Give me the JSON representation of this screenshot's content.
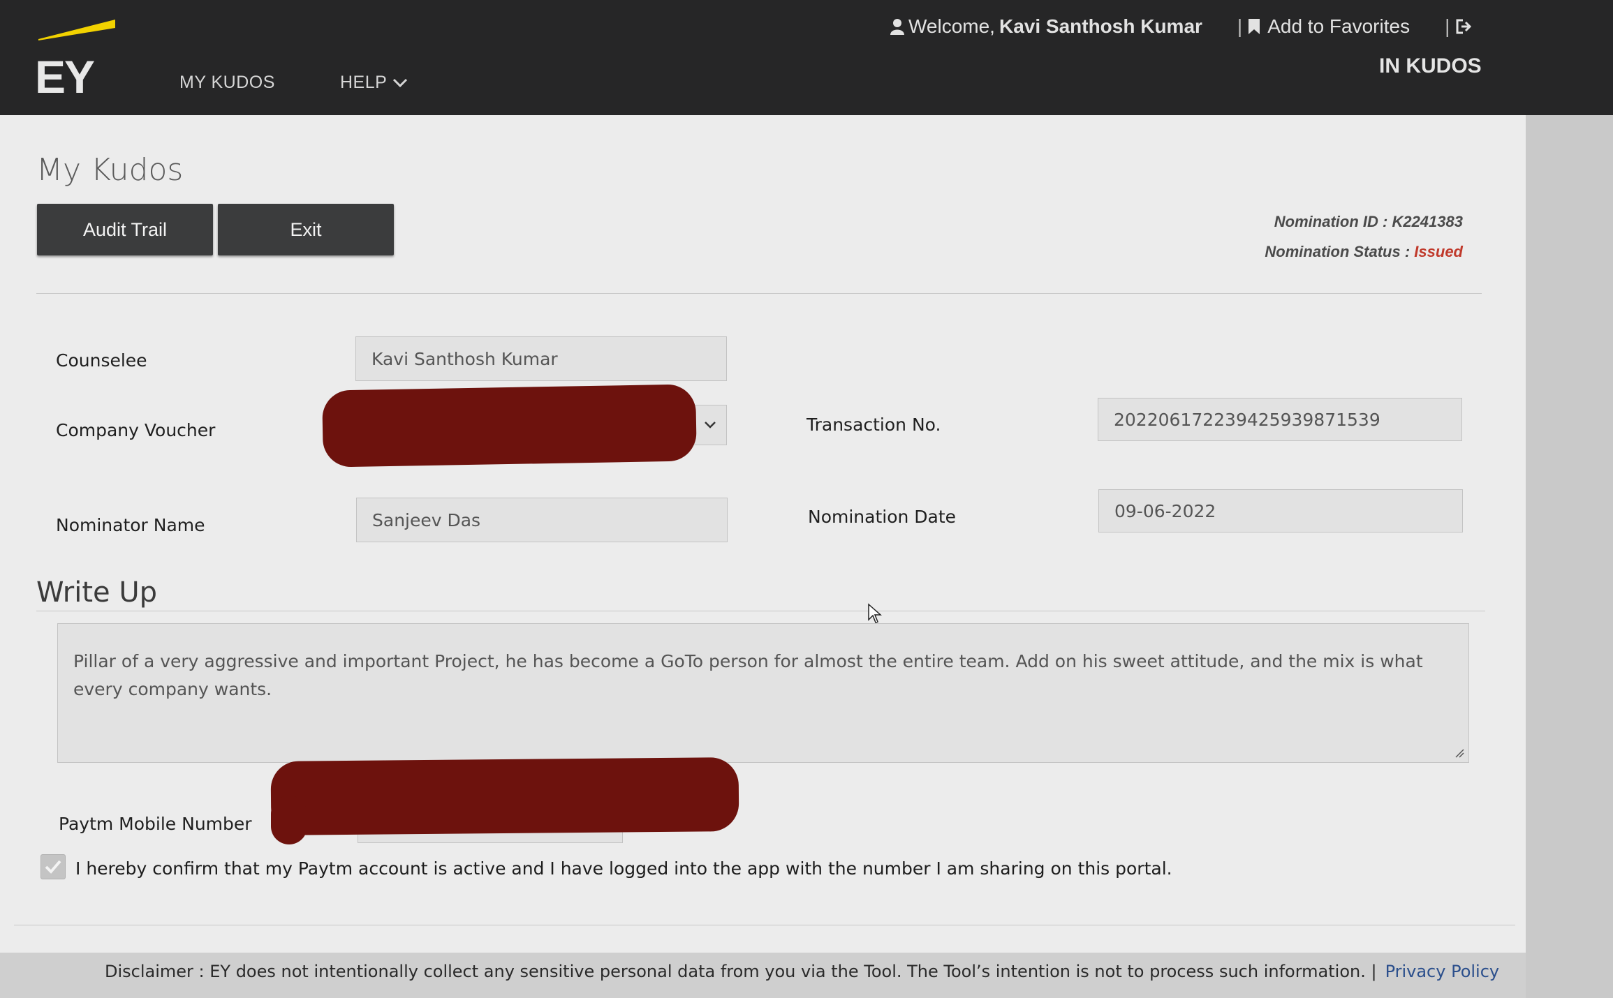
{
  "header": {
    "logo": "EY",
    "nav": {
      "my_kudos": "MY KUDOS",
      "help": "HELP"
    },
    "welcome_prefix": "Welcome,",
    "user_name": "Kavi Santhosh Kumar",
    "add_to_favorites": "Add to Favorites",
    "app_name": "IN KUDOS",
    "colors": {
      "bar": "#262627",
      "logo_accent": "#f2d200"
    }
  },
  "page": {
    "title": "My Kudos",
    "buttons": {
      "audit_trail": "Audit Trail",
      "exit": "Exit"
    },
    "nomination": {
      "id_label": "Nomination ID :",
      "id_value": "K2241383",
      "status_label": "Nomination Status :",
      "status_value": "Issued",
      "status_color": "#c0392b"
    }
  },
  "form": {
    "counselee_label": "Counselee",
    "counselee_value": "Kavi Santhosh Kumar",
    "company_voucher_label": "Company Voucher",
    "transaction_label": "Transaction No.",
    "transaction_value": "20220617223942593987153​9",
    "nominator_label": "Nominator Name",
    "nominator_value": "Sanjeev Das",
    "nomination_date_label": "Nomination Date",
    "nomination_date_value": "09-06-2022"
  },
  "write_up": {
    "title": "Write Up",
    "text": "Pillar of a very aggressive and important Project, he has become a GoTo person for almost the entire team. Add on his sweet attitude, and the mix is what every company wants."
  },
  "paytm": {
    "mobile_label": "Paytm Mobile Number",
    "confirm_checked": true,
    "confirm_text": "I hereby confirm that my Paytm account is active and I have logged into the app with the number I am sharing on this portal."
  },
  "footer": {
    "disclaimer": "Disclaimer : EY does not intentionally collect any sensitive personal data from you via the Tool. The Tool’s intention is not to process such information. |",
    "privacy_policy": "Privacy Policy"
  }
}
